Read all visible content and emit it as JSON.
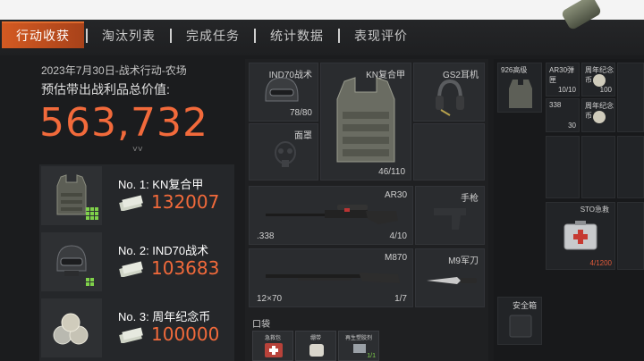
{
  "tabs": [
    {
      "label": "行动收获",
      "active": true
    },
    {
      "label": "淘汰列表",
      "active": false
    },
    {
      "label": "完成任务",
      "active": false
    },
    {
      "label": "统计数据",
      "active": false
    },
    {
      "label": "表现评价",
      "active": false
    }
  ],
  "summary": {
    "date_map": "2023年7月30日-战术行动-农场",
    "estimate_label": "预估带出战利品总价值:",
    "total_value": "563,732",
    "expand_icon": "chevron-down-icon"
  },
  "top_items": [
    {
      "rank": "No. 1: KN复合甲",
      "value": "132007",
      "icon": "vest-icon"
    },
    {
      "rank": "No. 2: IND70战术",
      "value": "103683",
      "icon": "helmet-icon"
    },
    {
      "rank": "No. 3: 周年纪念币",
      "value": "100000",
      "icon": "coins-icon"
    }
  ],
  "gear": {
    "helmet": {
      "label": "IND70战术",
      "count": "78/80"
    },
    "armor": {
      "label": "KN复合甲",
      "count": "46/110"
    },
    "headset": {
      "label": "GS2耳机"
    },
    "mask": {
      "label": "面罩"
    },
    "primary": {
      "label": "AR30",
      "ammo": ".338",
      "count": "4/10"
    },
    "pistol": {
      "label": "手枪"
    },
    "secondary": {
      "label": "M870",
      "ammo": "12×70",
      "count": "1/7"
    },
    "melee": {
      "label": "M9军刀"
    },
    "pocket_label": "口袋",
    "pockets": [
      {
        "label": "急救包"
      },
      {
        "label": "绷带"
      },
      {
        "label": "再生塑胶剂",
        "count": "1/1"
      }
    ]
  },
  "backpack": {
    "rig": {
      "label": "926高级"
    },
    "items": [
      {
        "label": "AR30弹匣",
        "count": "10/10"
      },
      {
        "label": "周年纪念币",
        "count": "100"
      },
      {
        "label": "338",
        "count": "30"
      },
      {
        "label": "周年纪念币",
        "count": ""
      },
      {
        "label": "STO急救",
        "count": "4/1200"
      }
    ],
    "safe_label": "安全箱"
  },
  "colors": {
    "accent": "#f26a3b",
    "tab_active": "#d35a22",
    "pip": "#7fd14a"
  }
}
